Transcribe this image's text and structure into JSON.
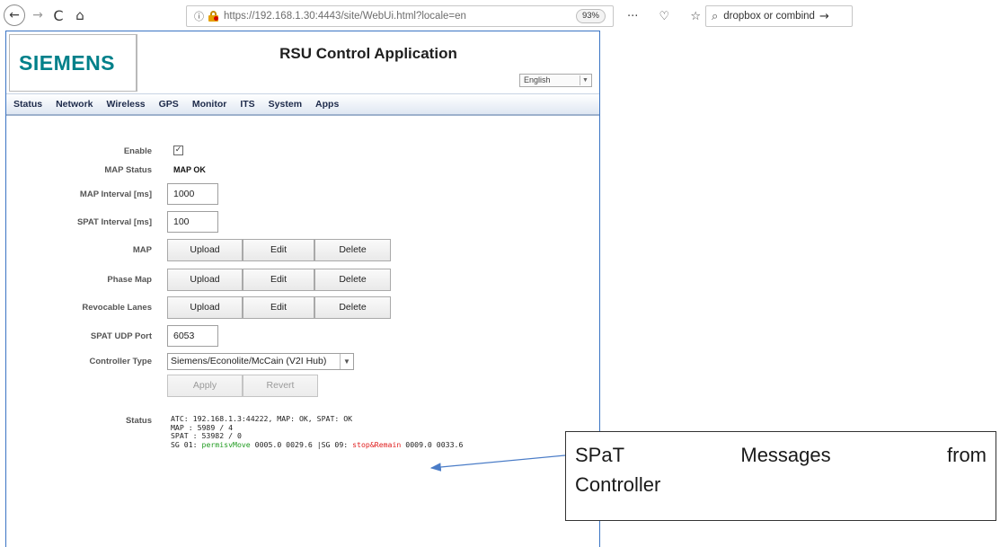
{
  "browser": {
    "back": "←",
    "forward": "→",
    "reload": "C",
    "home": "⌂",
    "info": "ⓘ",
    "url_host": "https://192.168.1.30",
    "url_rest": ":4443/site/WebUi.html?locale=en",
    "zoom": "93%",
    "more": "···",
    "pocket": "♡",
    "bookmark": "☆",
    "search_placeholder": "dropbox or combind",
    "search_go": "→"
  },
  "app": {
    "logo": "SIEMENS",
    "title": "RSU Control Application",
    "language": "English"
  },
  "menu": [
    "Status",
    "Network",
    "Wireless",
    "GPS",
    "Monitor",
    "ITS",
    "System",
    "Apps"
  ],
  "form": {
    "enable_label": "Enable",
    "enable_checked": "✓",
    "map_status_label": "MAP Status",
    "map_status_value": "MAP OK",
    "map_interval_label": "MAP Interval [ms]",
    "map_interval_value": "1000",
    "spat_interval_label": "SPAT Interval [ms]",
    "spat_interval_value": "100",
    "map_label": "MAP",
    "phase_map_label": "Phase Map",
    "revocable_lanes_label": "Revocable Lanes",
    "upload": "Upload",
    "edit": "Edit",
    "delete": "Delete",
    "spat_udp_port_label": "SPAT UDP Port",
    "spat_udp_port_value": "6053",
    "controller_type_label": "Controller Type",
    "controller_type_value": "Siemens/Econolite/McCain (V2I Hub)",
    "apply": "Apply",
    "revert": "Revert",
    "status_label": "Status"
  },
  "status": {
    "line1": "ATC: 192.168.1.3:44222, MAP: OK, SPAT: OK",
    "line2": "MAP : 5989 / 4",
    "line3": "SPAT : 53982 / 0",
    "sg1_prefix": "SG 01: ",
    "sg1_state": "permisvMove",
    "sg1_times": " 0005.0 0029.6 |SG 09: ",
    "sg9_state": "stop&Remain",
    "sg9_times": " 0009.0 0033.6"
  },
  "annotation": {
    "word1": "SPaT",
    "word2": "Messages",
    "word3": "from",
    "line2": "Controller"
  }
}
